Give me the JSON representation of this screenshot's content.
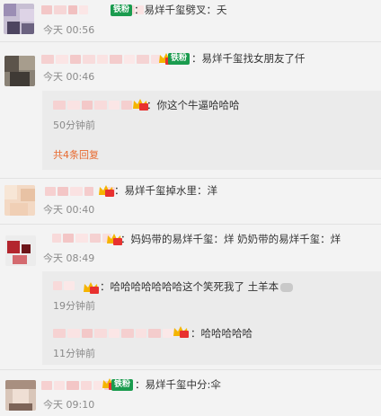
{
  "colors": {
    "accent": "#e8692f",
    "fan_badge": "#1a9b4e",
    "muted": "#8a8a8a"
  },
  "comments": [
    {
      "text": "：易烊千玺劈叉：夭",
      "time": "今天 00:56",
      "badge": "铁粉"
    },
    {
      "text": "：易烊千玺找女朋友了仟",
      "time": "今天 00:46",
      "badge": "铁粉",
      "replies": [
        {
          "text": "：你这个牛逼哈哈哈",
          "time": "50分钟前"
        }
      ],
      "more": "共4条回复"
    },
    {
      "text": "：易烊千玺掉水里：洋",
      "time": "今天 00:40"
    },
    {
      "text": "：妈妈带的易烊千玺：烊 奶奶带的易烊千玺：烊",
      "time": "今天 08:49",
      "replies": [
        {
          "text": "：哈哈哈哈哈哈哈这个笑死我了 土羊本",
          "time": "19分钟前"
        },
        {
          "text": "：哈哈哈哈哈",
          "time": "11分钟前"
        }
      ]
    },
    {
      "text": "：易烊千玺中分:伞",
      "time": "今天 09:10",
      "badge": "铁粉"
    }
  ],
  "icons": {
    "crown": "crown-badge-icon",
    "sheep": "sheep-emoji-icon"
  }
}
